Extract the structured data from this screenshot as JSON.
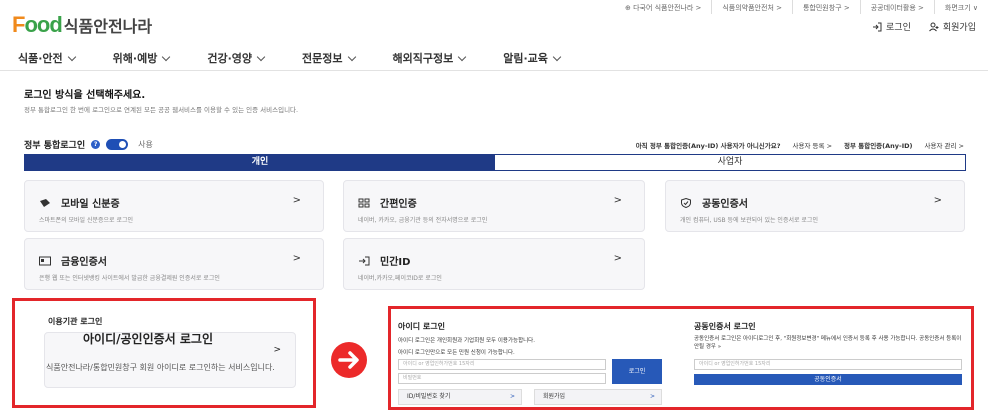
{
  "util_links": [
    "⊕ 다국어 식품안전나라 >",
    "식품의약품안전처 >",
    "통합민원창구 >",
    "공공데이터활용 >",
    "화면크기 ∨"
  ],
  "logo": {
    "food_f": "F",
    "food_ood": "ood",
    "korean": "식품안전나라"
  },
  "auth": {
    "login": "로그인",
    "signup": "회원가입"
  },
  "nav": [
    "식품·안전",
    "위해·예방",
    "건강·영양",
    "전문정보",
    "해외직구정보",
    "알림·교육"
  ],
  "title": "로그인 방식을 선택해주세요.",
  "subtitle": "정부 통합로그인 한 번에 로그인으로 연계된 모든 공공 웹서비스를 이용할 수 있는 인증 서비스입니다.",
  "gov_login": {
    "label": "정부 통합로그인",
    "help": "?",
    "toggle_state": "사용"
  },
  "any_id": {
    "question": "아직 정부 통합인증(Any-ID) 사용자가 아니신가요?",
    "register": "사용자 등록 >",
    "anyid_label": "정부 통합인증(Any-ID)",
    "manage": "사용자 관리 >"
  },
  "tabs": [
    "개인",
    "사업자"
  ],
  "cards": [
    {
      "title": "모바일 신분증",
      "desc": "스마트폰의 모바일 신분증으로 로그인"
    },
    {
      "title": "간편인증",
      "desc": "네이버, 카카오, 금융기관 등의 전자서명으로 로그인"
    },
    {
      "title": "공동인증서",
      "desc": "개인 컴퓨터, USB 등에 보관되어 있는 인증서로 로그인"
    },
    {
      "title": "금융인증서",
      "desc": "은행 웹 또는 인터넷뱅킹 사이트에서 발급한 금융결제원 인증서로 로그인"
    },
    {
      "title": "민간ID",
      "desc": "네이버,카카오,페이코ID로 로그인"
    }
  ],
  "arrow": ">",
  "agency": {
    "title": "이용기관 로그인",
    "card_label": "아이디/공인인증서 로그인",
    "desc": "식품안전나라/통합민원창구 회원 아이디로 로그인하는 서비스입니다."
  },
  "id_login": {
    "title": "아이디 로그인",
    "note1": "아이디 로그인은 개인회원과 기업회원 모두 이용가능합니다.",
    "note2": "아이디 로그인만으로 모든 민원 신청이 가능합니다.",
    "id_placeholder": "아이디 or 영업인허가번호 15자리",
    "pw_placeholder": "비밀번호",
    "login_button": "로그인",
    "find_button": "ID/비밀번호 찾기",
    "signup_button": "회원가입"
  },
  "cert_login": {
    "title": "공동인증서 로그인",
    "note": "공동인증서 로그인은 아이디로그인 후, \"회원정보변경\" 메뉴에서 인증서 등록 후 사용 가능합니다. 공동인증서 등록이 안될 경우 »",
    "input_placeholder": "아이디 or 영업인허가번호 15자리",
    "button": "공동인증서"
  },
  "colors": {
    "brand_orange": "#f08a1c",
    "brand_green": "#3aa24a",
    "navy": "#1f3a86",
    "red": "#e3262a",
    "blue": "#2759b8"
  }
}
